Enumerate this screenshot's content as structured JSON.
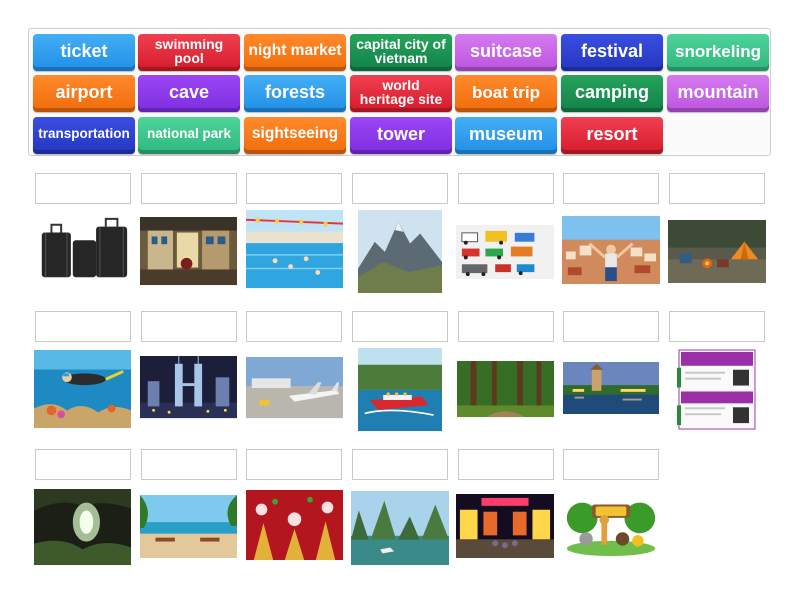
{
  "word_bank": {
    "title": "",
    "chips": [
      {
        "label": "ticket",
        "color": "blue"
      },
      {
        "label": "swimming pool",
        "color": "red"
      },
      {
        "label": "night market",
        "color": "orange"
      },
      {
        "label": "capital city of vietnam",
        "color": "green"
      },
      {
        "label": "suitcase",
        "color": "pink"
      },
      {
        "label": "festival",
        "color": "navy"
      },
      {
        "label": "snorkeling",
        "color": "teal"
      },
      {
        "label": "airport",
        "color": "orange"
      },
      {
        "label": "cave",
        "color": "violet"
      },
      {
        "label": "forests",
        "color": "blue"
      },
      {
        "label": "world heritage site",
        "color": "red"
      },
      {
        "label": "boat trip",
        "color": "orange"
      },
      {
        "label": "camping",
        "color": "green"
      },
      {
        "label": "mountain",
        "color": "pink"
      },
      {
        "label": "transportation",
        "color": "navy"
      },
      {
        "label": "national park",
        "color": "teal"
      },
      {
        "label": "sightseeing",
        "color": "orange"
      },
      {
        "label": "tower",
        "color": "violet"
      },
      {
        "label": "museum",
        "color": "blue"
      },
      {
        "label": "resort",
        "color": "red"
      }
    ]
  },
  "images": [
    {
      "icon": "suitcase-image"
    },
    {
      "icon": "museum-image"
    },
    {
      "icon": "swimming-pool-image"
    },
    {
      "icon": "mountain-image"
    },
    {
      "icon": "transportation-image"
    },
    {
      "icon": "sightseeing-image"
    },
    {
      "icon": "camping-image"
    },
    {
      "icon": "snorkeling-image"
    },
    {
      "icon": "tower-image"
    },
    {
      "icon": "airport-image"
    },
    {
      "icon": "boat-trip-image"
    },
    {
      "icon": "forests-image"
    },
    {
      "icon": "capital-city-image"
    },
    {
      "icon": "ticket-image"
    },
    {
      "icon": "cave-image"
    },
    {
      "icon": "resort-image"
    },
    {
      "icon": "festival-image"
    },
    {
      "icon": "world-heritage-site-image"
    },
    {
      "icon": "night-market-image"
    },
    {
      "icon": "national-park-image"
    }
  ],
  "ticket_image_text": {
    "header": "THE NATIONAL ZOO",
    "line1": "MATCH MADE IN WILDLIFE"
  },
  "colors": {
    "blue": "#2b9af0",
    "red": "#e02b3b",
    "orange": "#f77a1a",
    "green": "#1b8f50",
    "pink": "#c766e8",
    "navy": "#2c41cf",
    "teal": "#3cc489",
    "violet": "#8a38ea"
  }
}
